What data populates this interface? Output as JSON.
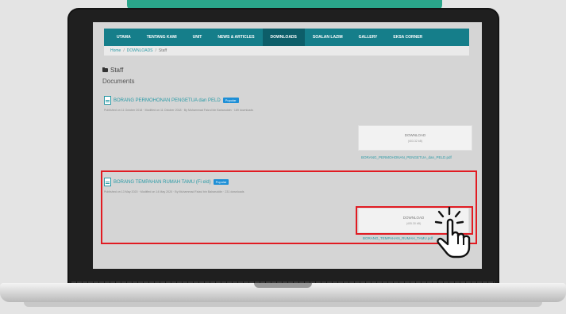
{
  "nav": {
    "items": [
      {
        "label": "UTAMA"
      },
      {
        "label": "TENTANG KAMI"
      },
      {
        "label": "UNIT"
      },
      {
        "label": "NEWS & ARTICLES"
      },
      {
        "label": "DOWNLOADS",
        "active": true
      },
      {
        "label": "SOALAN LAZIM"
      },
      {
        "label": "GALLERY"
      },
      {
        "label": "EKSA CORNER"
      }
    ]
  },
  "breadcrumb": {
    "items": [
      "Home",
      "DOWNLOADS",
      "Staff"
    ]
  },
  "folder": {
    "name": "Staff"
  },
  "documents_heading": "Documents",
  "documents": [
    {
      "title": "BORANG PERMOHONAN PENGETUA dan PELD",
      "badge": "Popular",
      "meta": "Published on 11 October 2018 · Modified on 11 October 2018 · By Muhammad Faizul bin Baharuddin · 189 downloads",
      "download_label": "DOWNLOAD",
      "size": "(403.32 kB)",
      "filename": "BORANG_PERMOHONAN_PENGETUA_dan_PELD.pdf"
    },
    {
      "title": "BORANG TEMPAHAN RUMAH TAMU (Fi eld)",
      "badge": "Popular",
      "meta": "Published on 13 May 2020 · Modified on 14 May 2020 · By Muhammad Faizul bin Baharuddin · 231 downloads",
      "download_label": "DOWNLOAD",
      "size": "(405.30 kB)",
      "filename": "BORANG_TEMPAHAN_RUMAH_TAMU.pdf"
    }
  ],
  "colors": {
    "nav": "#157e8a",
    "link": "#2a9aa6",
    "highlight": "#e11b22",
    "badge": "#1e8fd6"
  },
  "icons": {
    "folder": "folder-icon",
    "document": "file-icon",
    "cursor": "hand-pointer-icon"
  }
}
